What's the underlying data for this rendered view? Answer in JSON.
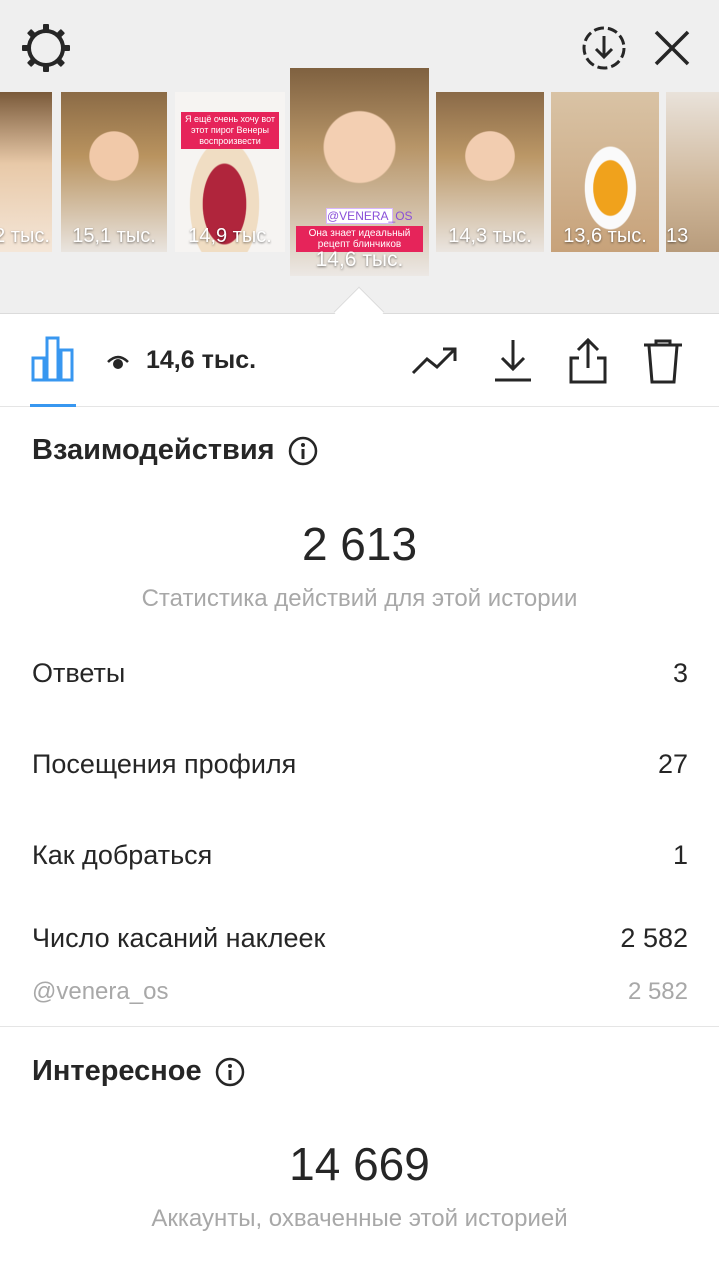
{
  "stories": [
    {
      "views": "2 тыс.",
      "caption": "",
      "tag": ""
    },
    {
      "views": "15,1 тыс.",
      "caption": "",
      "tag": ""
    },
    {
      "views": "14,9 тыс.",
      "caption": "Я ещё очень хочу вот этот пирог Венеры воспроизвести",
      "tag": ""
    },
    {
      "views": "14,6 тыс.",
      "caption": "Она знает идеальный рецепт блинчиков",
      "tag": "@VENERA_OS"
    },
    {
      "views": "14,3 тыс.",
      "caption": "",
      "tag": ""
    },
    {
      "views": "13,6 тыс.",
      "caption": "",
      "tag": ""
    },
    {
      "views": "13",
      "caption": "",
      "tag": ""
    }
  ],
  "toolbar": {
    "views": "14,6 тыс."
  },
  "interactions": {
    "title": "Взаимодействия",
    "total": "2 613",
    "subtitle": "Статистика действий для этой истории",
    "rows": [
      {
        "label": "Ответы",
        "value": "3"
      },
      {
        "label": "Посещения профиля",
        "value": "27"
      },
      {
        "label": "Как добраться",
        "value": "1"
      },
      {
        "label": "Число касаний наклеек",
        "value": "2 582"
      }
    ],
    "sub_row": {
      "label": "@venera_os",
      "value": "2 582"
    }
  },
  "discovery": {
    "title": "Интересное",
    "total": "14 669",
    "subtitle": "Аккаунты, охваченные этой историей"
  },
  "icons": {
    "settings": "gear-icon",
    "download_circle": "download-circle-icon",
    "close": "close-icon",
    "insights": "bar-chart-icon",
    "eye": "eye-icon",
    "promote": "trending-up-icon",
    "download": "download-icon",
    "share": "share-icon",
    "delete": "trash-icon",
    "info": "info-icon"
  },
  "colors": {
    "accent": "#3897f0",
    "text": "#262626",
    "secondary": "#a8a8a8",
    "header_bg": "#efefef"
  }
}
